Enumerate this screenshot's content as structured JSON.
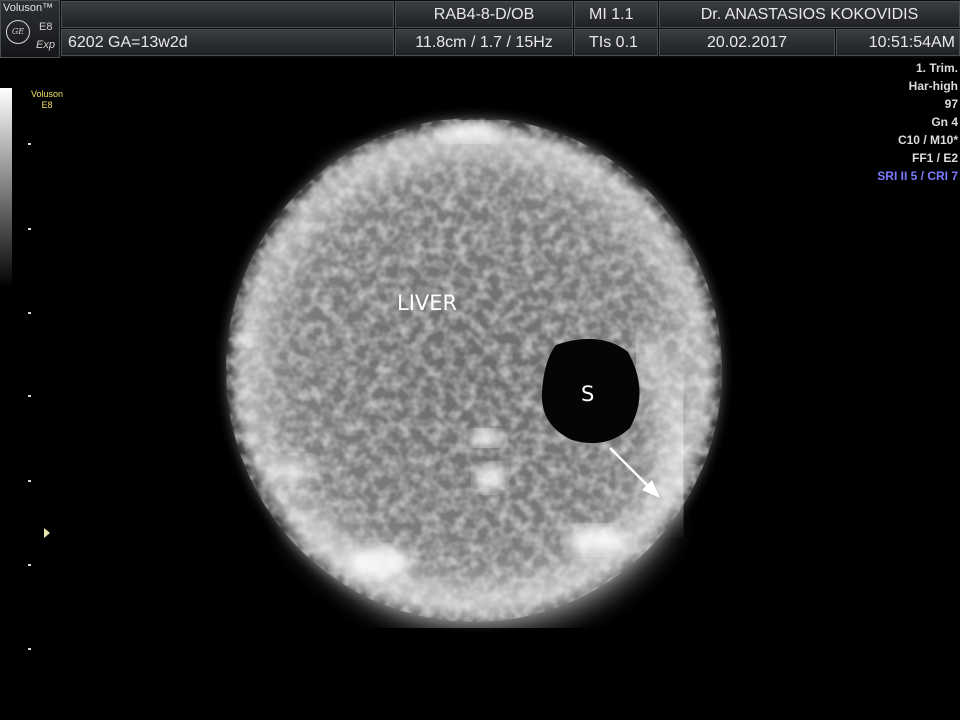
{
  "header": {
    "brand": {
      "name": "Voluson™",
      "model": "E8",
      "mode": "Exp"
    },
    "row1": {
      "probe": "RAB4-8-D/OB",
      "mi": "MI  1.1",
      "doctor": "Dr. ANASTASIOS KOKOVIDIS"
    },
    "row2": {
      "patient": "6202  GA=13w2d",
      "depth": "11.8cm / 1.7 / 15Hz",
      "tis": "TIs  0.1",
      "date": "20.02.2017",
      "time": "10:51:54AM"
    }
  },
  "left_panel": {
    "tag_line1": "Voluson",
    "tag_line2": "E8"
  },
  "params": [
    "1. Trim.",
    "Har-high",
    "97",
    "Gn   4",
    "C10 / M10*",
    "FF1 / E2",
    "SRI II 5 / CRI 7"
  ],
  "image": {
    "labels": {
      "liver": "LIVER",
      "stomach": "S"
    }
  },
  "colors": {
    "params_highlight": "#7b7cff",
    "tag": "#f0e060"
  }
}
